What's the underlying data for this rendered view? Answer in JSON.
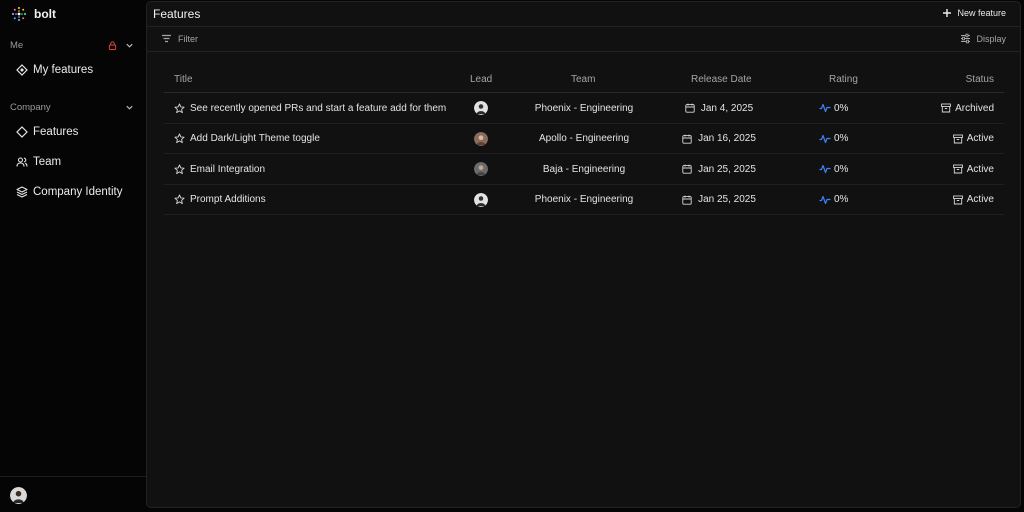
{
  "app": {
    "name": "bolt"
  },
  "sidebar": {
    "me_label": "Me",
    "my_features": "My features",
    "company_label": "Company",
    "items": [
      {
        "label": "Features",
        "icon": "diamond-icon"
      },
      {
        "label": "Team",
        "icon": "users-icon"
      },
      {
        "label": "Company Identity",
        "icon": "layers-icon"
      }
    ]
  },
  "header": {
    "title": "Features",
    "new_feature": "New feature"
  },
  "toolbar": {
    "filter": "Filter",
    "display": "Display"
  },
  "table": {
    "columns": {
      "title": "Title",
      "lead": "Lead",
      "team": "Team",
      "release_date": "Release Date",
      "rating": "Rating",
      "status": "Status"
    },
    "rows": [
      {
        "title": "See recently opened PRs and start a feature add for them",
        "team": "Phoenix - Engineering",
        "date": "Jan 4, 2025",
        "rating": "0%",
        "status": "Archived"
      },
      {
        "title": "Add Dark/Light Theme toggle",
        "team": "Apollo - Engineering",
        "date": "Jan 16, 2025",
        "rating": "0%",
        "status": "Active"
      },
      {
        "title": "Email Integration",
        "team": "Baja - Engineering",
        "date": "Jan 25, 2025",
        "rating": "0%",
        "status": "Active"
      },
      {
        "title": "Prompt Additions",
        "team": "Phoenix - Engineering",
        "date": "Jan 25, 2025",
        "rating": "0%",
        "status": "Active"
      }
    ]
  },
  "colors": {
    "accent": "#3b82f6",
    "lock": "#e0443a",
    "background": "#050505",
    "panel": "#111111"
  }
}
